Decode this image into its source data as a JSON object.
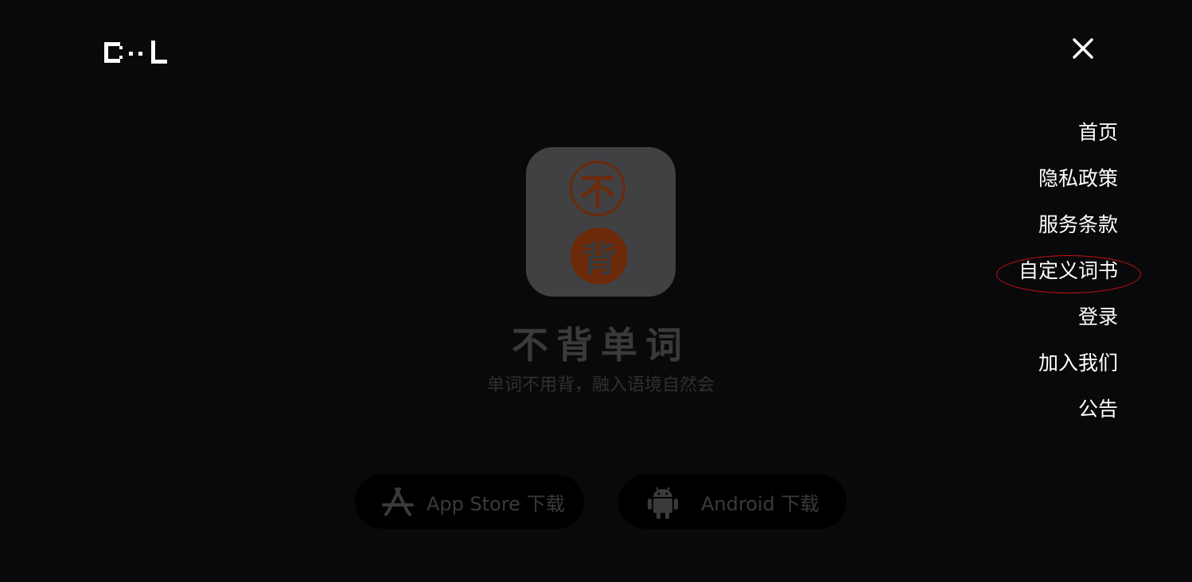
{
  "header": {
    "logo_icon": "cl-pixel-logo-icon",
    "close_icon": "close-icon"
  },
  "hero": {
    "app_icon_top_char": "不",
    "app_icon_bottom_char": "背",
    "app_name": "不背单词",
    "tagline": "单词不用背，融入语境自然会",
    "brand_color": "#6c2a0a"
  },
  "downloads": {
    "appstore_label": "App Store 下载",
    "appstore_icon": "app-store-icon",
    "android_label": "Android 下载",
    "android_icon": "android-icon"
  },
  "menu": {
    "items": [
      {
        "label": "首页"
      },
      {
        "label": "隐私政策"
      },
      {
        "label": "服务条款"
      },
      {
        "label": "自定义词书"
      },
      {
        "label": "登录"
      },
      {
        "label": "加入我们"
      },
      {
        "label": "公告"
      }
    ]
  },
  "annotation": {
    "ring_color": "#d01010"
  }
}
